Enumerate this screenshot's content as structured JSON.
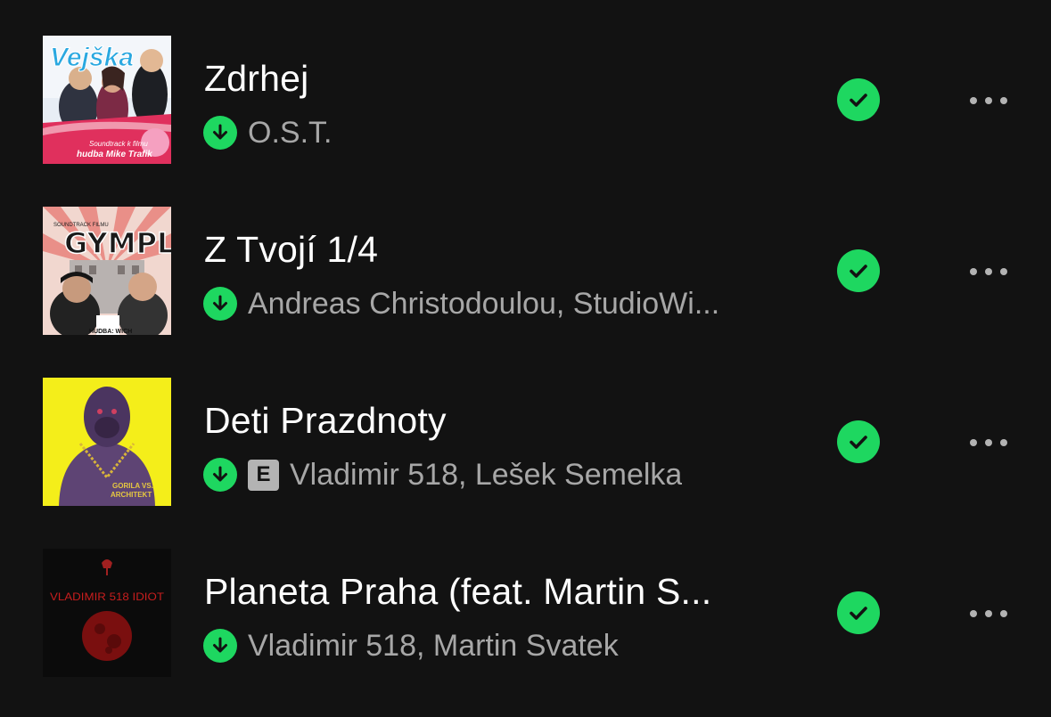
{
  "colors": {
    "background": "#121212",
    "accent_green": "#1ed760",
    "title_text": "#ffffff",
    "subtitle_text": "#a7a7a7"
  },
  "tracks": [
    {
      "title": "Zdrhej",
      "subtitle": "O.S.T.",
      "explicit": false,
      "downloaded": true,
      "saved": true,
      "cover": {
        "icon": "album-cover-vejska",
        "logo_text": "Vejška",
        "caption_line1": "Soundtrack k filmu",
        "caption_line2": "hudba Mike Trafik"
      }
    },
    {
      "title": "Z Tvojí 1/4",
      "subtitle": "Andreas Christodoulou, StudioWi...",
      "explicit": false,
      "downloaded": true,
      "saved": true,
      "cover": {
        "icon": "album-cover-gympl",
        "logo_text": "GYMPL",
        "caption_line1": "SOUNDTRACK FILMU",
        "caption_line2": "HUDBA: WICH"
      }
    },
    {
      "title": "Deti Prazdnoty",
      "subtitle": "Vladimir 518, Lešek Semelka",
      "explicit": true,
      "explicit_label": "E",
      "downloaded": true,
      "saved": true,
      "cover": {
        "icon": "album-cover-gorila-vs-architekt",
        "caption_line1": "GORILA VS.",
        "caption_line2": "ARCHITEKT"
      }
    },
    {
      "title": "Planeta Praha (feat. Martin S...",
      "subtitle": "Vladimir 518, Martin Svatek",
      "explicit": false,
      "downloaded": true,
      "saved": true,
      "cover": {
        "icon": "album-cover-idiot",
        "logo_text": "VLADIMIR 518 IDIOT"
      }
    }
  ]
}
